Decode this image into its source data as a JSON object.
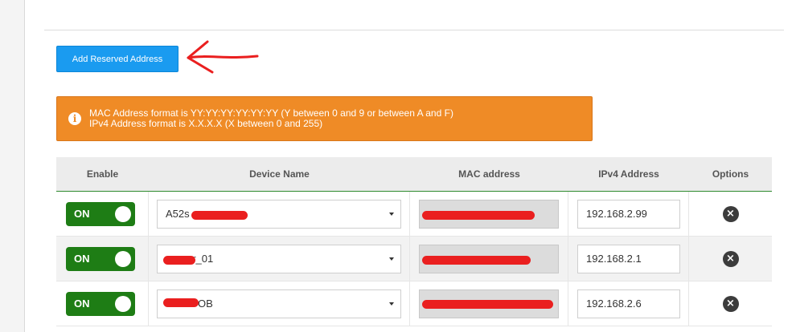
{
  "add_button_label": "Add Reserved Address",
  "alert": {
    "icon": "info-icon",
    "line1": "MAC Address format is YY:YY:YY:YY:YY:YY (Y between 0 and 9 or between A and F)",
    "line2": "IPv4 Address format is X.X.X.X (X between 0 and 255)",
    "color": "#ef8b26"
  },
  "table": {
    "headers": [
      "Enable",
      "Device Name",
      "MAC address",
      "IPv4 Address",
      "Options"
    ],
    "rows": [
      {
        "enable": "ON",
        "device": "A52s",
        "mac": "",
        "ipv4": "192.168.2.99"
      },
      {
        "enable": "ON",
        "device": "er_01",
        "mac": "",
        "ipv4": "192.168.2.1"
      },
      {
        "enable": "ON",
        "device": "OB",
        "mac": "",
        "ipv4": "192.168.2.6"
      }
    ],
    "delete_icon": "close-icon"
  },
  "colors": {
    "accent": "#1a9bf0",
    "toggle_on": "#1e7d15",
    "annotation": "#ea1f1f"
  }
}
